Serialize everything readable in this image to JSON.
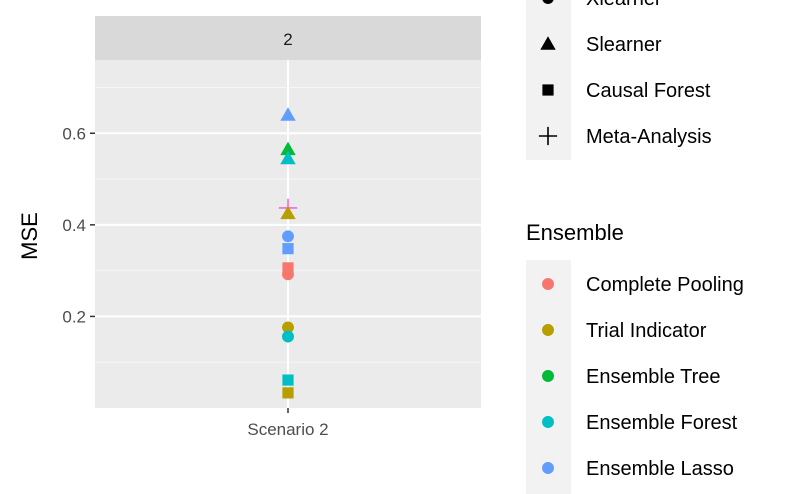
{
  "chart_data": {
    "type": "scatter",
    "facet_label": "2",
    "ylabel": "MSE",
    "xlabel": "",
    "x_categories": [
      "Scenario 2"
    ],
    "ylim": [
      0.0,
      0.76
    ],
    "y_ticks": [
      {
        "value": 0.2,
        "label": "0.2"
      },
      {
        "value": 0.4,
        "label": "0.4"
      },
      {
        "value": 0.6,
        "label": "0.6"
      }
    ],
    "grid": true,
    "points": [
      {
        "x": "Scenario 2",
        "y": 0.64,
        "shape": "triangle",
        "color": "#619CFF"
      },
      {
        "x": "Scenario 2",
        "y": 0.565,
        "shape": "triangle",
        "color": "#00BA38"
      },
      {
        "x": "Scenario 2",
        "y": 0.545,
        "shape": "triangle",
        "color": "#00BFC4"
      },
      {
        "x": "Scenario 2",
        "y": 0.437,
        "shape": "cross",
        "color": "#F564E3"
      },
      {
        "x": "Scenario 2",
        "y": 0.425,
        "shape": "triangle",
        "color": "#B79F00"
      },
      {
        "x": "Scenario 2",
        "y": 0.375,
        "shape": "circle",
        "color": "#619CFF"
      },
      {
        "x": "Scenario 2",
        "y": 0.348,
        "shape": "square",
        "color": "#619CFF"
      },
      {
        "x": "Scenario 2",
        "y": 0.306,
        "shape": "square",
        "color": "#F8766D"
      },
      {
        "x": "Scenario 2",
        "y": 0.292,
        "shape": "circle",
        "color": "#F8766D"
      },
      {
        "x": "Scenario 2",
        "y": 0.176,
        "shape": "circle",
        "color": "#B79F00"
      },
      {
        "x": "Scenario 2",
        "y": 0.156,
        "shape": "circle",
        "color": "#00BFC4"
      },
      {
        "x": "Scenario 2",
        "y": 0.061,
        "shape": "square",
        "color": "#00BFC4"
      },
      {
        "x": "Scenario 2",
        "y": 0.033,
        "shape": "square",
        "color": "#B79F00"
      }
    ],
    "legend_shape": {
      "partial_first_entry": {
        "label": "Xlearner",
        "shape": "circle"
      },
      "entries": [
        {
          "label": "Slearner",
          "shape": "triangle"
        },
        {
          "label": "Causal Forest",
          "shape": "square"
        },
        {
          "label": "Meta-Analysis",
          "shape": "cross"
        }
      ]
    },
    "legend_color": {
      "title": "Ensemble",
      "entries": [
        {
          "label": "Complete Pooling",
          "color": "#F8766D"
        },
        {
          "label": "Trial Indicator",
          "color": "#B79F00"
        },
        {
          "label": "Ensemble Tree",
          "color": "#00BA38"
        },
        {
          "label": "Ensemble Forest",
          "color": "#00BFC4"
        },
        {
          "label": "Ensemble Lasso",
          "color": "#619CFF"
        }
      ]
    },
    "legend_placement": "right"
  }
}
